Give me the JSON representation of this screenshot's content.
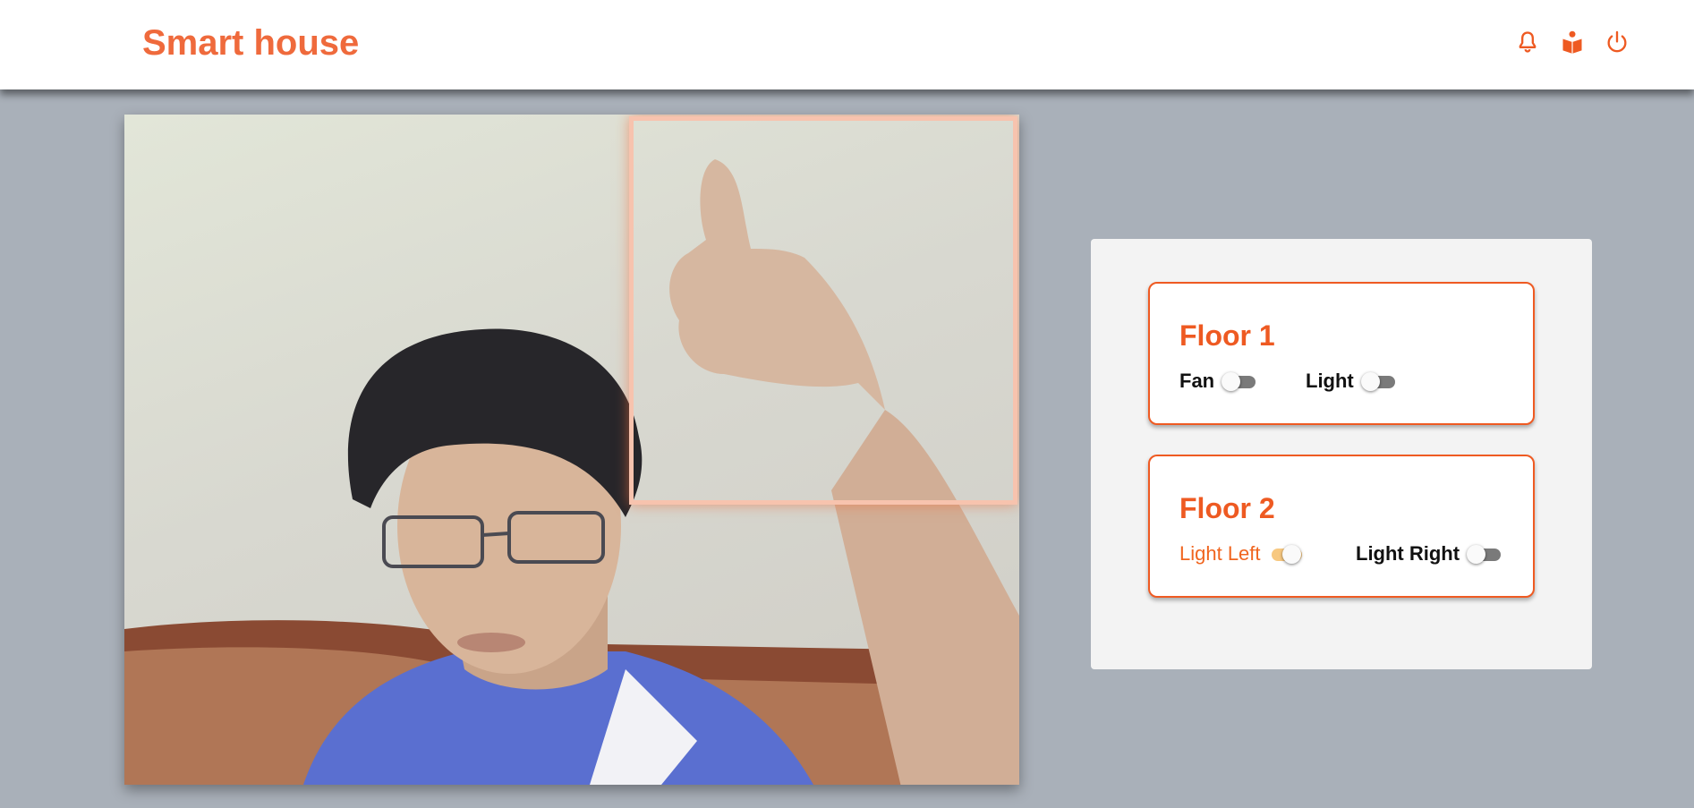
{
  "header": {
    "brand": "Smart house",
    "icons": [
      "bell-icon",
      "book-reader-icon",
      "power-icon"
    ]
  },
  "camera": {
    "detection": "thumbs-up"
  },
  "floors": [
    {
      "title": "Floor 1",
      "devices": [
        {
          "label": "Fan",
          "on": false
        },
        {
          "label": "Light",
          "on": false
        }
      ]
    },
    {
      "title": "Floor 2",
      "devices": [
        {
          "label": "Light Left",
          "on": true
        },
        {
          "label": "Light Right",
          "on": false
        }
      ]
    }
  ],
  "colors": {
    "accent": "#ee5a22",
    "brand": "#ef6a3c",
    "background": "#a9b0b9",
    "panel": "#f3f3f3",
    "switch_on": "#f7c880",
    "switch_off": "#7a7a7a"
  }
}
